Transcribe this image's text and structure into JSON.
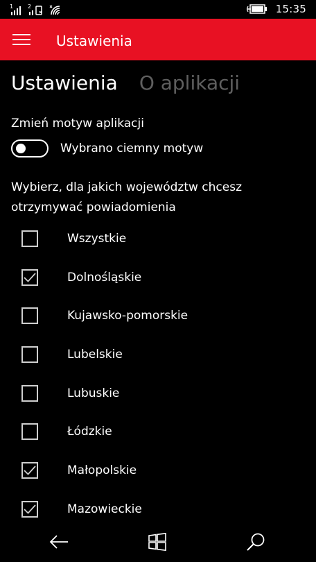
{
  "status": {
    "sim1": "1",
    "sim2": "2",
    "time": "15:35"
  },
  "appbar": {
    "title": "Ustawienia"
  },
  "pivot": {
    "items": [
      {
        "label": "Ustawienia",
        "active": true
      },
      {
        "label": "O aplikacji",
        "active": false
      }
    ]
  },
  "settings": {
    "theme_label": "Zmień motyw aplikacji",
    "theme_toggle_on": false,
    "theme_toggle_text": "Wybrano ciemny motyw",
    "voivodeship_label": "Wybierz, dla jakich województw chcesz otrzymywać powiadomienia",
    "voivodeships": [
      {
        "label": "Wszystkie",
        "checked": false
      },
      {
        "label": "Dolnośląskie",
        "checked": true
      },
      {
        "label": "Kujawsko-pomorskie",
        "checked": false
      },
      {
        "label": "Lubelskie",
        "checked": false
      },
      {
        "label": "Lubuskie",
        "checked": false
      },
      {
        "label": "Łódzkie",
        "checked": false
      },
      {
        "label": "Małopolskie",
        "checked": true
      },
      {
        "label": "Mazowieckie",
        "checked": true
      }
    ]
  },
  "colors": {
    "accent": "#e81123",
    "background": "#000000",
    "inactive_pivot": "#5f5f5f"
  },
  "icons": {
    "menu": "hamburger-icon",
    "back": "back-arrow-icon",
    "home": "windows-logo-icon",
    "search": "search-icon"
  }
}
